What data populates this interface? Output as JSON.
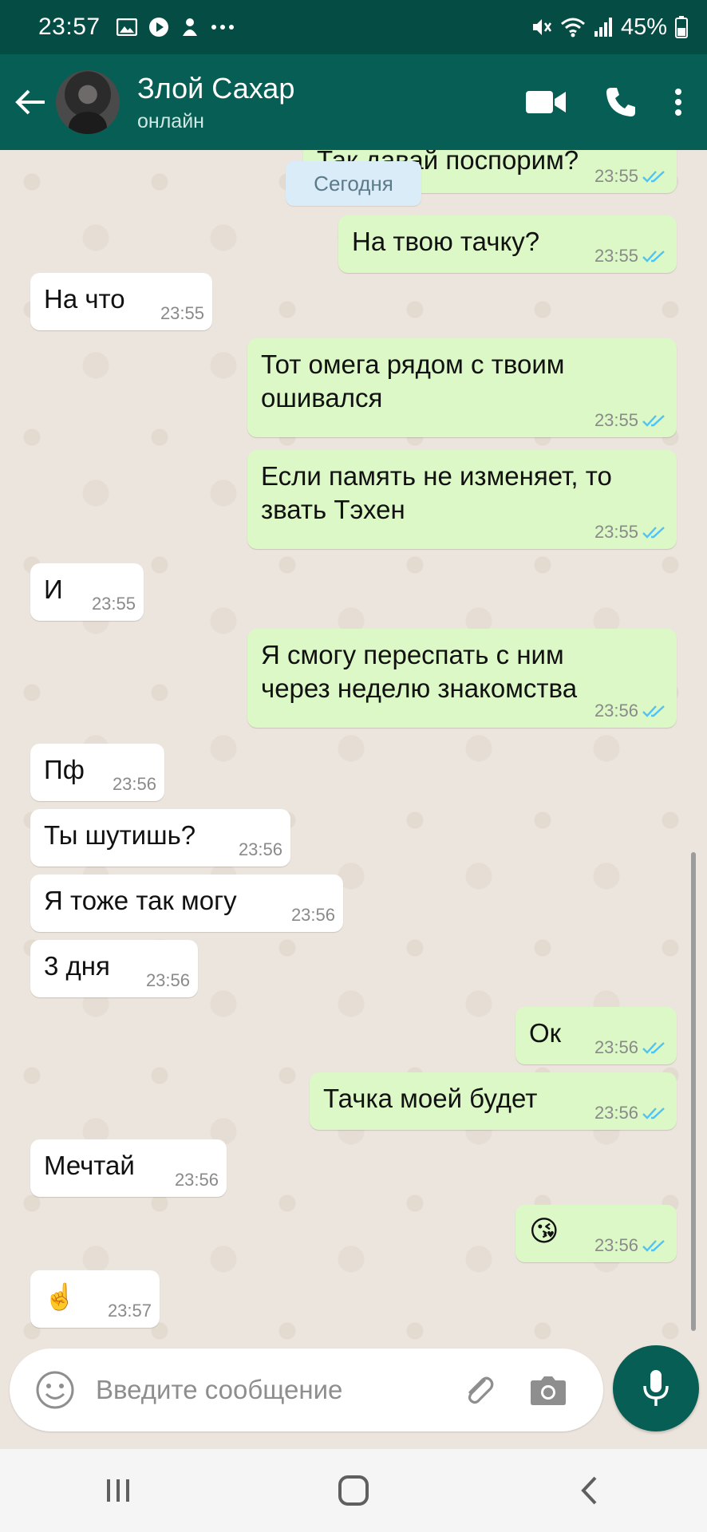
{
  "status_bar": {
    "time": "23:57",
    "battery": "45%",
    "icons": [
      "image-icon",
      "play-icon",
      "app-icon",
      "more-dots-icon",
      "mute-icon",
      "wifi-icon",
      "signal-icon",
      "battery-icon"
    ]
  },
  "header": {
    "contact_name": "Злой Сахар",
    "contact_status": "онлайн",
    "color": "#075e54"
  },
  "chat": {
    "date_label": "Сегодня",
    "partial_message": {
      "text": "Так давай поспорим?",
      "time": "23:55"
    },
    "messages": [
      {
        "direction": "out",
        "text": "На твою тачку?",
        "time": "23:55"
      },
      {
        "direction": "in",
        "text": "На что",
        "time": "23:55"
      },
      {
        "direction": "out",
        "text": "Тот омега рядом с твоим\nошивался",
        "time": "23:55"
      },
      {
        "direction": "out",
        "text": "Если память не изменяет, то\nзвать Тэхен",
        "time": "23:55"
      },
      {
        "direction": "in",
        "text": "И",
        "time": "23:55"
      },
      {
        "direction": "out",
        "text": "Я смогу переспать с ним\nчерез неделю знакомства",
        "time": "23:56"
      },
      {
        "direction": "in",
        "text": "Пф",
        "time": "23:56"
      },
      {
        "direction": "in",
        "text": "Ты шутишь?",
        "time": "23:56"
      },
      {
        "direction": "in",
        "text": "Я тоже так могу",
        "time": "23:56"
      },
      {
        "direction": "in",
        "text": "3 дня",
        "time": "23:56"
      },
      {
        "direction": "out",
        "text": "Ок",
        "time": "23:56"
      },
      {
        "direction": "out",
        "text": "Тачка моей будет",
        "time": "23:56"
      },
      {
        "direction": "in",
        "text": "Мечтай",
        "time": "23:56"
      },
      {
        "direction": "out",
        "text": "😘",
        "time": "23:56"
      },
      {
        "direction": "in",
        "text": "☝️",
        "time": "23:57"
      }
    ],
    "colors": {
      "outgoing": "#dcf8c6",
      "incoming": "#ffffff",
      "read_ticks": "#4fc3f7"
    }
  },
  "input_bar": {
    "placeholder": "Введите сообщение",
    "value": ""
  }
}
